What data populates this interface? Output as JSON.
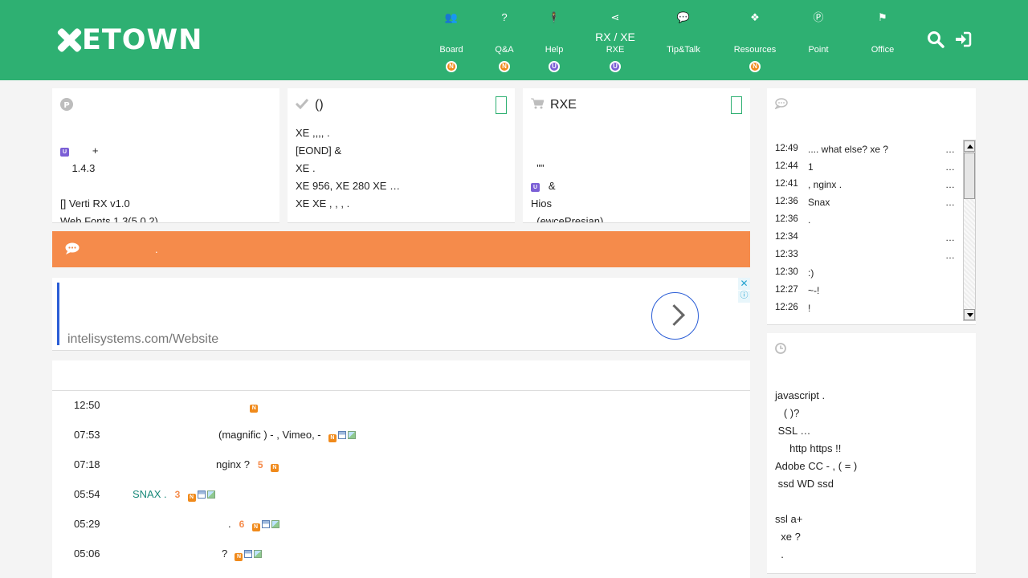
{
  "header": {
    "logo_text": "ETOWN",
    "nav": [
      {
        "icon": "users-icon",
        "glyph": "👥",
        "top_label": "",
        "label": "Board",
        "badge": "N",
        "badge_type": "n"
      },
      {
        "icon": "question-icon",
        "glyph": "?",
        "top_label": "",
        "label": "Q&A",
        "badge": "N",
        "badge_type": "n"
      },
      {
        "icon": "help-person-icon",
        "glyph": "🕴",
        "top_label": "",
        "label": "Help",
        "badge": "U",
        "badge_type": "u"
      },
      {
        "icon": "share-icon",
        "glyph": "⋖",
        "top_label": "RX / XE",
        "label": "RXE",
        "badge": "U",
        "badge_type": "u"
      },
      {
        "icon": "comments-icon",
        "glyph": "💬",
        "top_label": "",
        "label": "Tip&Talk",
        "badge": "",
        "badge_type": ""
      },
      {
        "icon": "cubes-icon",
        "glyph": "❖",
        "top_label": "",
        "label": "Resources",
        "badge": "N",
        "badge_type": "n"
      },
      {
        "icon": "point-icon",
        "glyph": "Ⓟ",
        "top_label": "",
        "label": "Point",
        "badge": "",
        "badge_type": ""
      },
      {
        "icon": "flag-icon",
        "glyph": "⚑",
        "top_label": "",
        "label": "Office",
        "badge": "",
        "badge_type": ""
      }
    ]
  },
  "panel_point": {
    "icon": "point-icon",
    "lines": [
      "+",
      "1.4.3",
      "",
      "[] Verti RX v1.0",
      "Web Fonts 1.3(5.0.2)"
    ]
  },
  "panel_check": {
    "title": "()",
    "lines": [
      "XE ,,,, .",
      "[EOND] &",
      "XE .",
      "XE 956, XE 280 XE …",
      "XE XE , , , ."
    ]
  },
  "panel_shop": {
    "title": "RXE",
    "lines": [
      "\"\"",
      "&",
      "Hios",
      "(ewcePresian)"
    ]
  },
  "notice": {
    "text": "."
  },
  "ad": {
    "url": "intelisystems.com/Website"
  },
  "latest": [
    {
      "time": "12:50",
      "title": "",
      "count": "",
      "teal": false,
      "icons": [
        "n"
      ]
    },
    {
      "time": "07:53",
      "title": "(magnific ) - , Vimeo, -",
      "count": "",
      "teal": false,
      "icons": [
        "n",
        "disk",
        "img"
      ]
    },
    {
      "time": "07:18",
      "title": "nginx ?",
      "count": "5",
      "teal": false,
      "icons": [
        "n"
      ]
    },
    {
      "time": "05:54",
      "title": "SNAX .",
      "count": "3",
      "teal": true,
      "icons": [
        "n",
        "disk",
        "img"
      ]
    },
    {
      "time": "05:29",
      "title": ".",
      "count": "6",
      "teal": false,
      "icons": [
        "n",
        "disk",
        "img"
      ]
    },
    {
      "time": "05:06",
      "title": "?",
      "count": "",
      "teal": false,
      "icons": [
        "n",
        "disk",
        "img"
      ]
    }
  ],
  "chat": [
    {
      "time": "12:49",
      "msg": ".... what else? xe ?",
      "more": "…"
    },
    {
      "time": "12:44",
      "msg": "1",
      "more": "…"
    },
    {
      "time": "12:41",
      "msg": ", nginx .",
      "more": "…"
    },
    {
      "time": "12:36",
      "msg": "Snax",
      "more": "…"
    },
    {
      "time": "12:36",
      "msg": ".",
      "more": ""
    },
    {
      "time": "12:34",
      "msg": "",
      "more": "…"
    },
    {
      "time": "12:33",
      "msg": "",
      "more": "…"
    },
    {
      "time": "12:30",
      "msg": ":)",
      "more": ""
    },
    {
      "time": "12:27",
      "msg": "~-!",
      "more": ""
    },
    {
      "time": "12:26",
      "msg": "!",
      "more": ""
    }
  ],
  "recent": [
    "javascript .",
    "( )?",
    "SSL …",
    "http https !!",
    "Adobe CC - , ( = )",
    "ssd WD ssd",
    "",
    "ssl a+",
    "xe ?",
    "."
  ]
}
